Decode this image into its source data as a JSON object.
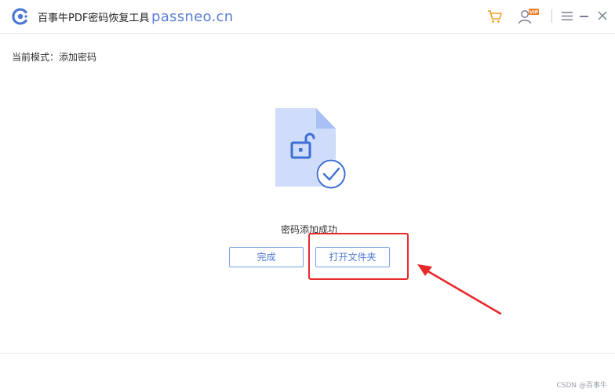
{
  "titlebar": {
    "app_title": "百事牛PDF密码恢复工具",
    "site": "passneo.cn",
    "icons": {
      "logo": "app-logo-icon",
      "cart": "cart-icon",
      "user": "user-vip-icon",
      "vip_badge": "VIP",
      "menu": "menu-icon",
      "minimize": "minimize-icon",
      "close": "close-icon"
    }
  },
  "mode_label": "当前模式：添加密码",
  "status_text": "密码添加成功",
  "buttons": {
    "done": "完成",
    "open_folder": "打开文件夹"
  },
  "illustration": {
    "file_icon": "document-unlocked-icon",
    "check_icon": "check-circle-icon"
  },
  "watermark": "CSDN @百事牛",
  "colors": {
    "accent": "#4f79d6",
    "site_text": "#5b7fd6",
    "cart": "#f0a020",
    "annotation": "#e8292a"
  }
}
